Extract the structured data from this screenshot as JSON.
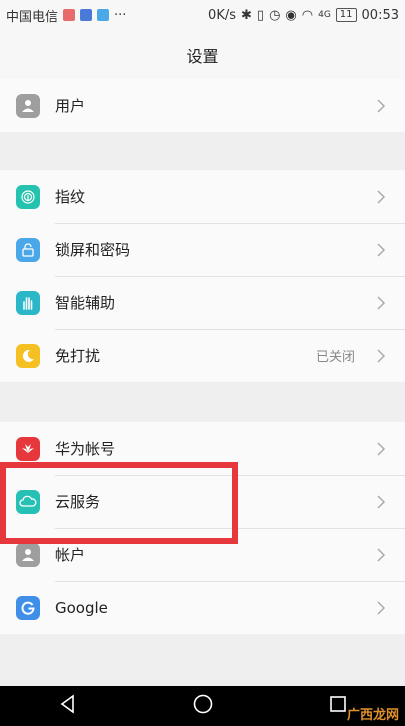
{
  "status_bar": {
    "carrier": "中国电信",
    "speed": "0K/s",
    "network": "4G",
    "battery": "11",
    "time": "00:53"
  },
  "header": {
    "title": "设置"
  },
  "groups": [
    {
      "items": [
        {
          "label": "用户",
          "icon": "user-icon"
        }
      ]
    },
    {
      "items": [
        {
          "label": "指纹",
          "icon": "fingerprint-icon"
        },
        {
          "label": "锁屏和密码",
          "icon": "lock-icon"
        },
        {
          "label": "智能辅助",
          "icon": "hand-icon"
        },
        {
          "label": "免打扰",
          "icon": "moon-icon",
          "value": "已关闭"
        }
      ]
    },
    {
      "items": [
        {
          "label": "华为帐号",
          "icon": "huawei-icon"
        },
        {
          "label": "云服务",
          "icon": "cloud-icon"
        },
        {
          "label": "帐户",
          "icon": "account-icon"
        },
        {
          "label": "Google",
          "icon": "google-icon"
        }
      ]
    }
  ],
  "watermark": "广西龙网",
  "colors": {
    "user": "#9e9e9e",
    "fingerprint": "#26c2b0",
    "lock": "#4ba8e8",
    "hand": "#2bb7c7",
    "moon": "#f5c022",
    "huawei": "#e5373c",
    "cloud": "#27c0b4",
    "account": "#9e9e9e",
    "google": "#3f8ee8",
    "highlight": "#e5373c"
  }
}
